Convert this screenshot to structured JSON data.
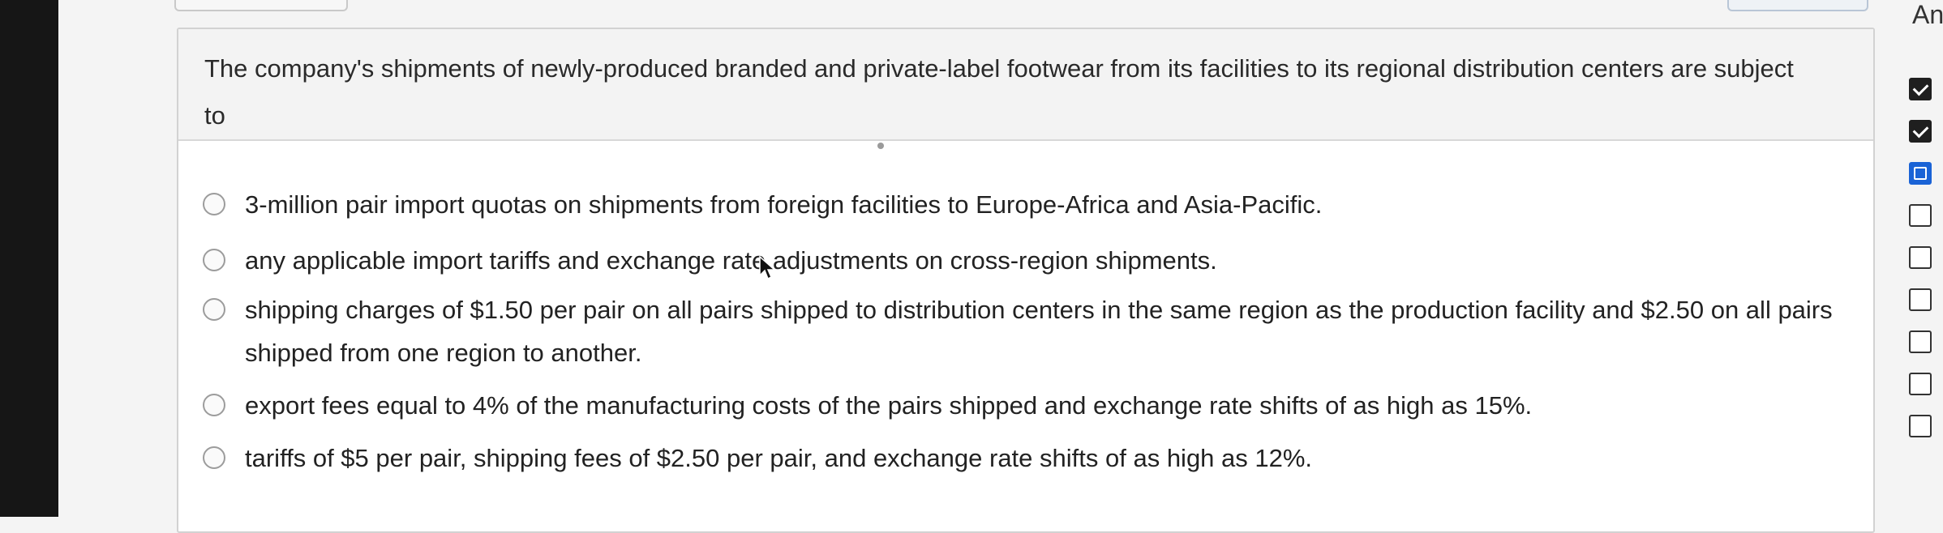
{
  "question": {
    "text": "The company's shipments of newly-produced branded and private-label footwear from its facilities to its regional distribution centers are subject to"
  },
  "options": [
    {
      "label": "3-million pair import quotas on shipments from foreign facilities to Europe-Africa and Asia-Pacific."
    },
    {
      "label": "any applicable import tariffs and exchange rate adjustments on cross-region shipments."
    },
    {
      "label": "shipping charges of $1.50 per pair on all pairs shipped to distribution centers in the same region as the production facility and $2.50 on all pairs shipped from one region to another."
    },
    {
      "label": "export fees equal to 4% of the manufacturing costs of the pairs shipped and exchange rate shifts of as high as 15%."
    },
    {
      "label": "tariffs of $5 per pair, shipping fees of $2.50 per pair, and exchange rate shifts of as high as 12%."
    }
  ],
  "side_panel": {
    "label": "An",
    "nav_states": [
      "done",
      "done",
      "current",
      "empty",
      "empty",
      "empty",
      "empty",
      "empty",
      "empty"
    ]
  }
}
